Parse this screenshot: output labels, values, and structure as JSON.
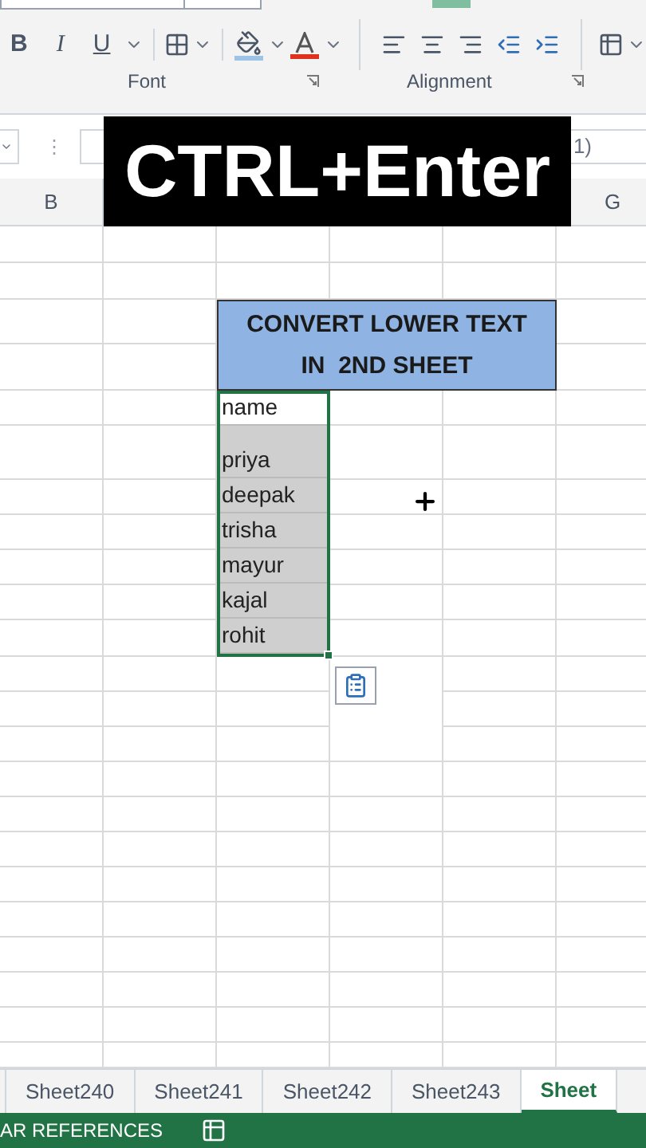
{
  "ribbon": {
    "font_buttons": [
      "B",
      "I",
      "U"
    ],
    "groups": [
      "Font",
      "Alignment"
    ]
  },
  "formula_bar": {
    "separator": "⋮",
    "value": "1)"
  },
  "overlay_caption": "CTRL+Enter",
  "column_headers": [
    "B",
    "G"
  ],
  "title_cell": {
    "lines": [
      "CONVERT LOWER TEXT",
      "IN  2ND SHEET"
    ]
  },
  "names": [
    {
      "text": "name",
      "highlighted": false
    },
    {
      "text": "priya",
      "highlighted": true
    },
    {
      "text": "deepak",
      "highlighted": true
    },
    {
      "text": "trisha",
      "highlighted": true
    },
    {
      "text": "mayur",
      "highlighted": true
    },
    {
      "text": "kajal",
      "highlighted": true
    },
    {
      "text": "rohit",
      "highlighted": true
    }
  ],
  "sheet_tabs": [
    {
      "label": "Sheet240",
      "selected": false
    },
    {
      "label": "Sheet241",
      "selected": false
    },
    {
      "label": "Sheet242",
      "selected": false
    },
    {
      "label": "Sheet243",
      "selected": false
    },
    {
      "label": "Sheet",
      "selected": true
    }
  ],
  "status_bar": {
    "text": "AR REFERENCES"
  }
}
